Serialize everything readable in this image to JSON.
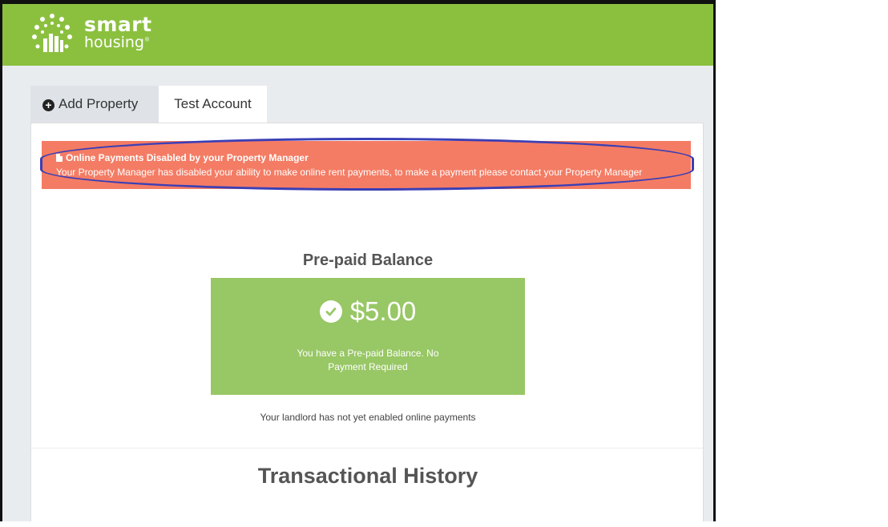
{
  "brand": {
    "name_line1": "smart",
    "name_line2": "housing",
    "trademark": "®"
  },
  "tabs": [
    {
      "label": "Add Property",
      "icon": "plus-circle-icon",
      "active": false
    },
    {
      "label": "Test Account",
      "active": true
    }
  ],
  "alert": {
    "icon": "document-icon",
    "title": "Online Payments Disabled by your Property Manager",
    "message": "Your Property Manager has disabled your ability to make online rent payments, to make a payment please contact your Property Manager",
    "background": "#f47c64",
    "highlight_color": "#3b3fb6"
  },
  "balance": {
    "heading": "Pre-paid Balance",
    "icon": "check-circle-icon",
    "amount": "$5.00",
    "note": "You have a Pre-paid Balance. No Payment Required",
    "background": "#98c765"
  },
  "landlord_note": "Your landlord has not yet enabled online payments",
  "history": {
    "heading": "Transactional History"
  },
  "colors": {
    "header": "#8bc03f",
    "page_bg": "#e9ecef"
  }
}
